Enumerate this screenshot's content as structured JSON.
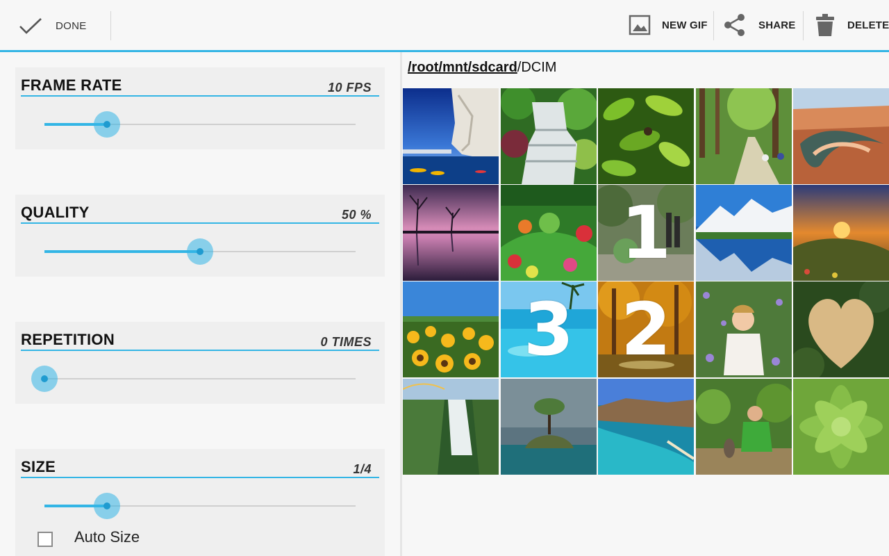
{
  "actionbar": {
    "done_label": "DONE",
    "new_gif_label": "NEW GIF",
    "share_label": "SHARE",
    "delete_label": "DELETE",
    "accent": "#33b5e5"
  },
  "settings": {
    "frame_rate": {
      "title": "FRAME RATE",
      "value": "10 FPS",
      "level": 0.2
    },
    "quality": {
      "title": "QUALITY",
      "value": "50 %",
      "level": 0.5
    },
    "repetition": {
      "title": "REPETITION",
      "value": "0 TIMES",
      "level": 0.0
    },
    "size": {
      "title": "SIZE",
      "value": "1/4",
      "level": 0.2,
      "auto_size_label": "Auto Size",
      "auto_size_checked": false
    }
  },
  "browser": {
    "path_root": "/root/mnt/sdcard",
    "path_current": "/DCIM",
    "photos": [
      {
        "name": "cliff-kayaks",
        "selection": ""
      },
      {
        "name": "waterfall-garden",
        "selection": ""
      },
      {
        "name": "jungle-leaves",
        "selection": ""
      },
      {
        "name": "forest-bike-path",
        "selection": ""
      },
      {
        "name": "canyon-river",
        "selection": ""
      },
      {
        "name": "purple-lake-trees",
        "selection": ""
      },
      {
        "name": "flower-garden",
        "selection": ""
      },
      {
        "name": "park-statues",
        "selection": "1"
      },
      {
        "name": "mountain-lake",
        "selection": ""
      },
      {
        "name": "sunset-valley",
        "selection": ""
      },
      {
        "name": "sunflower-field",
        "selection": ""
      },
      {
        "name": "tropical-pool",
        "selection": "3"
      },
      {
        "name": "autumn-forest",
        "selection": "2"
      },
      {
        "name": "child-flowers",
        "selection": ""
      },
      {
        "name": "heart-lake",
        "selection": ""
      },
      {
        "name": "victoria-falls",
        "selection": ""
      },
      {
        "name": "tree-island",
        "selection": ""
      },
      {
        "name": "bay-beach",
        "selection": ""
      },
      {
        "name": "man-with-cat",
        "selection": ""
      },
      {
        "name": "succulent",
        "selection": ""
      }
    ]
  }
}
